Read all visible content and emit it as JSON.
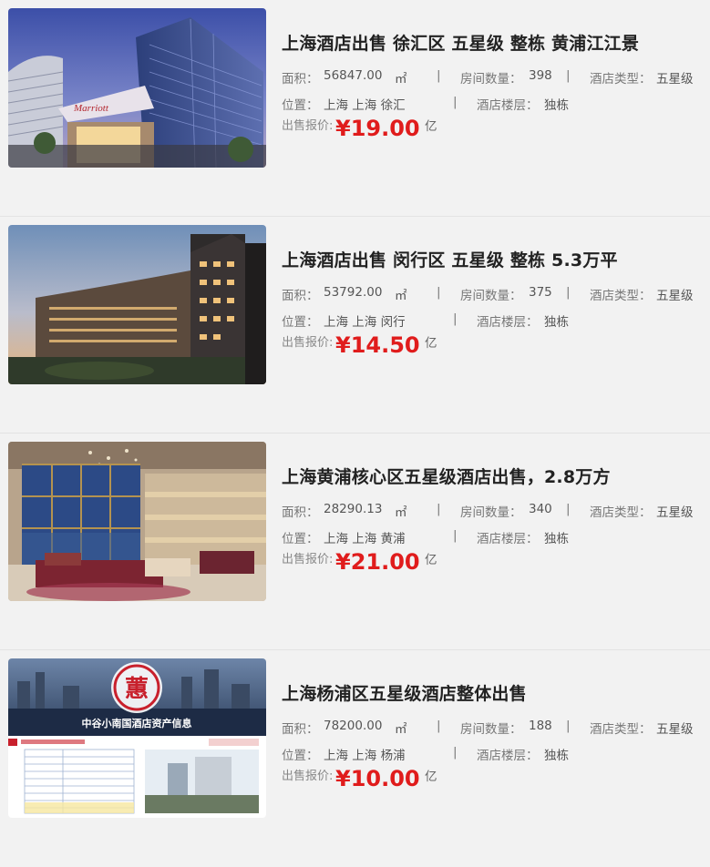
{
  "listings": [
    {
      "title": "上海酒店出售 徐汇区 五星级 整栋 黄浦江江景",
      "area_label": "面积：",
      "area": "56847.00",
      "area_unit": "㎡",
      "rooms_label": "房间数量：",
      "rooms": "398",
      "type_label": "酒店类型：",
      "type": "五星级",
      "loc_label": "位置：",
      "location": "上海 上海 徐汇",
      "floor_label": "酒店楼层：",
      "floor": "独栋",
      "price_label": "出售报价:",
      "price": "¥19.00",
      "price_unit": "亿",
      "image_sign": "Marriott"
    },
    {
      "title": "上海酒店出售 闵行区 五星级 整栋 5.3万平",
      "area_label": "面积：",
      "area": "53792.00",
      "area_unit": "㎡",
      "rooms_label": "房间数量：",
      "rooms": "375",
      "type_label": "酒店类型：",
      "type": "五星级",
      "loc_label": "位置：",
      "location": "上海 上海 闵行",
      "floor_label": "酒店楼层：",
      "floor": "独栋",
      "price_label": "出售报价:",
      "price": "¥14.50",
      "price_unit": "亿"
    },
    {
      "title": "上海黄浦核心区五星级酒店出售，2.8万方",
      "area_label": "面积：",
      "area": "28290.13",
      "area_unit": "㎡",
      "rooms_label": "房间数量：",
      "rooms": "340",
      "type_label": "酒店类型：",
      "type": "五星级",
      "loc_label": "位置：",
      "location": "上海 上海 黄浦",
      "floor_label": "酒店楼层：",
      "floor": "独栋",
      "price_label": "出售报价:",
      "price": "¥21.00",
      "price_unit": "亿"
    },
    {
      "title": "上海杨浦区五星级酒店整体出售",
      "area_label": "面积：",
      "area": "78200.00",
      "area_unit": "㎡",
      "rooms_label": "房间数量：",
      "rooms": "188",
      "type_label": "酒店类型：",
      "type": "五星级",
      "loc_label": "位置：",
      "location": "上海 上海 杨浦",
      "floor_label": "酒店楼层：",
      "floor": "独栋",
      "price_label": "出售报价:",
      "price": "¥10.00",
      "price_unit": "亿",
      "image_banner": "中谷小南国酒店资产信息",
      "image_logo": "蕙"
    }
  ],
  "separator": "|",
  "colors": {
    "price": "#e01c1c",
    "background": "#f2f2f2"
  }
}
